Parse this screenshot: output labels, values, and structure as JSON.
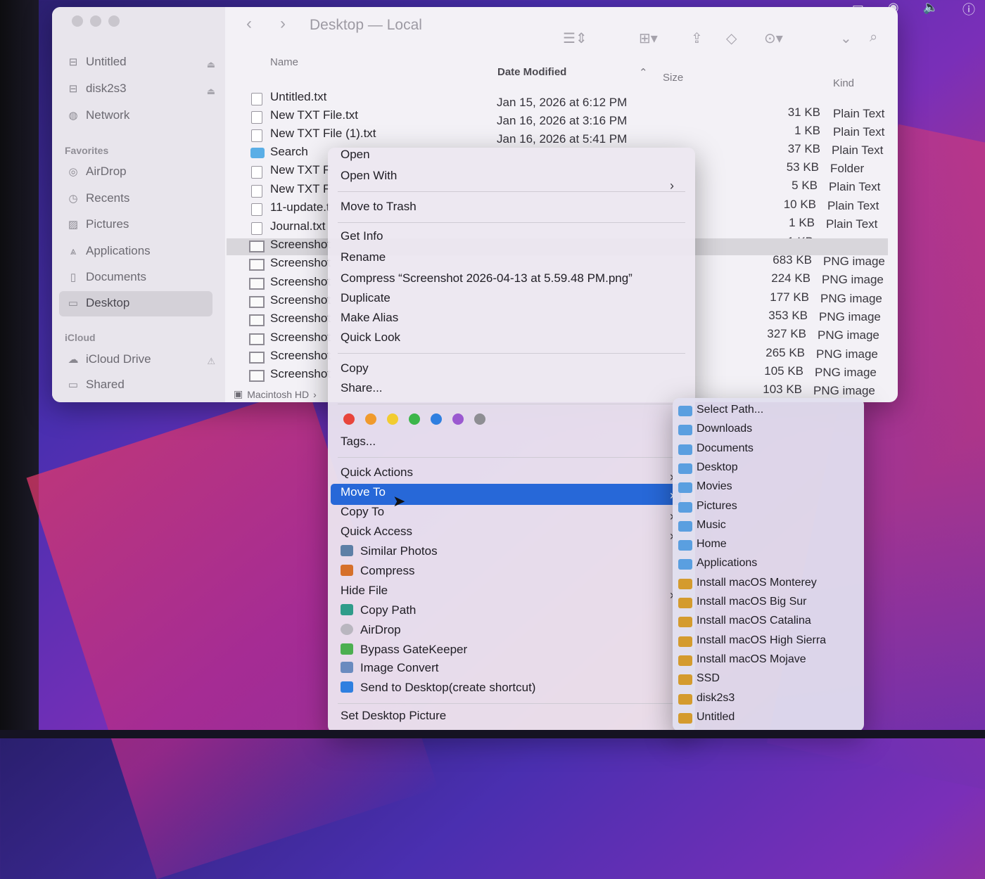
{
  "window": {
    "title": "Desktop — Local"
  },
  "sidebar": {
    "locations": [
      {
        "label": "Untitled",
        "icon": "drive-icon"
      },
      {
        "label": "disk2s3",
        "icon": "drive-icon"
      },
      {
        "label": "Network",
        "icon": "globe-icon"
      }
    ],
    "favorites_title": "Favorites",
    "favorites": [
      {
        "label": "AirDrop",
        "icon": "airdrop-icon"
      },
      {
        "label": "Recents",
        "icon": "clock-icon"
      },
      {
        "label": "Pictures",
        "icon": "photo-icon"
      },
      {
        "label": "Applications",
        "icon": "apps-icon"
      },
      {
        "label": "Documents",
        "icon": "document-icon"
      },
      {
        "label": "Desktop",
        "icon": "desktop-icon",
        "selected": true
      }
    ],
    "icloud_title": "iCloud",
    "icloud": [
      {
        "label": "iCloud Drive",
        "icon": "cloud-icon"
      },
      {
        "label": "Shared",
        "icon": "shared-folder-icon"
      }
    ]
  },
  "columns": {
    "name": "Name",
    "date": "Date Modified",
    "size": "Size",
    "kind": "Kind"
  },
  "files": [
    {
      "name": "Untitled.txt",
      "date": "Jan 15, 2026 at 6:12 PM",
      "size": "31 KB",
      "kind": "Plain Text"
    },
    {
      "name": "New TXT File.txt",
      "date": "Jan 16, 2026 at 3:16 PM",
      "size": "1 KB",
      "kind": "Plain Text"
    },
    {
      "name": "New TXT File (1).txt",
      "date": "Jan 16, 2026 at 5:41 PM",
      "size": "37 KB",
      "kind": "Plain Text"
    },
    {
      "name": "Search",
      "date": "",
      "size": "53 KB",
      "kind": "Folder"
    },
    {
      "name": "New TXT F",
      "date": "",
      "size": "5 KB",
      "kind": "Plain Text"
    },
    {
      "name": "New TXT F",
      "date": "",
      "size": "10 KB",
      "kind": "Plain Text"
    },
    {
      "name": "11-update.t",
      "date": "",
      "size": "1 KB",
      "kind": "Plain Text"
    },
    {
      "name": "Journal.txt",
      "date": "",
      "size": "1 KB",
      "kind": "Plain Text"
    },
    {
      "name": "Screenshot",
      "date": "",
      "size": "683 KB",
      "kind": "PNG image"
    },
    {
      "name": "Screenshot",
      "date": "",
      "size": "224 KB",
      "kind": "PNG image"
    },
    {
      "name": "Screenshot",
      "date": "",
      "size": "177 KB",
      "kind": "PNG image"
    },
    {
      "name": "Screenshot",
      "date": "",
      "size": "353 KB",
      "kind": "PNG image"
    },
    {
      "name": "Screenshot",
      "date": "",
      "size": "327 KB",
      "kind": "PNG image"
    },
    {
      "name": "Screenshot",
      "date": "",
      "size": "265 KB",
      "kind": "PNG image"
    },
    {
      "name": "Screenshot",
      "date": "",
      "size": "105 KB",
      "kind": "PNG image"
    },
    {
      "name": "Screenshot",
      "date": "",
      "size": "103 KB",
      "kind": "PNG image"
    }
  ],
  "statusbar": {
    "path": "Macintosh HD"
  },
  "context_menu": {
    "open": "Open",
    "open_with": "Open With",
    "move_to_trash": "Move to Trash",
    "get_info": "Get Info",
    "rename": "Rename",
    "compress_file": "Compress “Screenshot 2026-04-13 at 5.59.48 PM.png”",
    "duplicate": "Duplicate",
    "make_alias": "Make Alias",
    "quick_look": "Quick Look",
    "copy": "Copy",
    "share": "Share...",
    "tag_colors": [
      "#e8453c",
      "#f09a2c",
      "#f2cc30",
      "#3cb64a",
      "#2f7fe0",
      "#9b59d0",
      "#8e8e93"
    ],
    "tags": "Tags...",
    "quick_actions": "Quick Actions",
    "move_to": "Move To",
    "copy_to": "Copy To",
    "quick_access": "Quick Access",
    "similar_photos": "Similar Photos",
    "compress": "Compress",
    "hide_file": "Hide File",
    "copy_path": "Copy Path",
    "airdrop": "AirDrop",
    "bypass_gatekeeper": "Bypass GateKeeper",
    "image_convert": "Image Convert",
    "send_to_desktop": "Send to Desktop(create shortcut)",
    "set_desktop_picture": "Set Desktop Picture"
  },
  "move_to_submenu": [
    {
      "label": "Select Path...",
      "color": "blue"
    },
    {
      "label": "Downloads",
      "color": "blue"
    },
    {
      "label": "Documents",
      "color": "blue"
    },
    {
      "label": "Desktop",
      "color": "blue"
    },
    {
      "label": "Movies",
      "color": "blue"
    },
    {
      "label": "Pictures",
      "color": "blue"
    },
    {
      "label": "Music",
      "color": "blue"
    },
    {
      "label": "Home",
      "color": "blue"
    },
    {
      "label": "Applications",
      "color": "blue"
    },
    {
      "label": "Install macOS Monterey",
      "color": "orange"
    },
    {
      "label": "Install macOS Big Sur",
      "color": "orange"
    },
    {
      "label": "Install macOS Catalina",
      "color": "orange"
    },
    {
      "label": "Install macOS High Sierra",
      "color": "orange"
    },
    {
      "label": "Install macOS Mojave",
      "color": "orange"
    },
    {
      "label": "SSD",
      "color": "orange"
    },
    {
      "label": "disk2s3",
      "color": "orange"
    },
    {
      "label": "Untitled",
      "color": "orange"
    }
  ],
  "colors": {
    "highlight": "#2768d8",
    "folder_blue": "#5a9fe0",
    "folder_orange": "#d49b2e"
  }
}
